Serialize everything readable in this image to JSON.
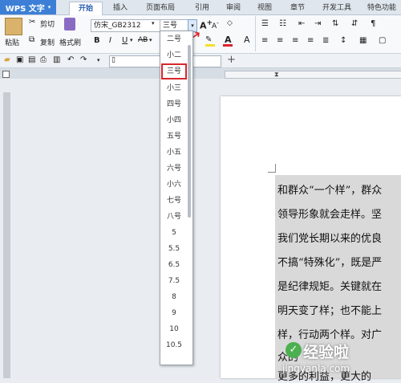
{
  "app": {
    "menu_label": "WPS 文字"
  },
  "tabs": [
    {
      "label": "开始"
    },
    {
      "label": "插入"
    },
    {
      "label": "页面布局"
    },
    {
      "label": "引用"
    },
    {
      "label": "审阅"
    },
    {
      "label": "视图"
    },
    {
      "label": "章节"
    },
    {
      "label": "开发工具"
    },
    {
      "label": "特色功能"
    }
  ],
  "ribbon": {
    "paste_label": "粘贴",
    "cut_label": "剪切",
    "copy_label": "复制",
    "format_painter_label": "格式刷",
    "font_name": "仿宋_GB2312",
    "font_size": "三号",
    "bold": "B",
    "italic": "I",
    "underline": "U",
    "strikethrough": "AB",
    "grow_font": "A",
    "shrink_font": "A"
  },
  "quickbar": {
    "doc_box": ""
  },
  "font_size_options": [
    "二号",
    "小二",
    "三号",
    "小三",
    "四号",
    "小四",
    "五号",
    "小五",
    "六号",
    "小六",
    "七号",
    "八号",
    "5",
    "5.5",
    "6.5",
    "7.5",
    "8",
    "9",
    "10",
    "10.5"
  ],
  "selected_font_size": "三号",
  "document_lines": [
    "和群众“一个样”，群众",
    "领导形象就会走样。坚",
    "我们党长期以来的优良",
    "不搞“特殊化”，既是严",
    "是纪律规矩。关键就在",
    "明天变了样；也不能上",
    "样，行动两个样。对广",
    "众的",
    "更多的利益，更大的"
  ],
  "watermark": {
    "main": "经验啦",
    "sub": "jingyanla.com",
    "check": "✓"
  },
  "colors": {
    "accent": "#3d7fd6",
    "selection_border": "#d9262b"
  }
}
